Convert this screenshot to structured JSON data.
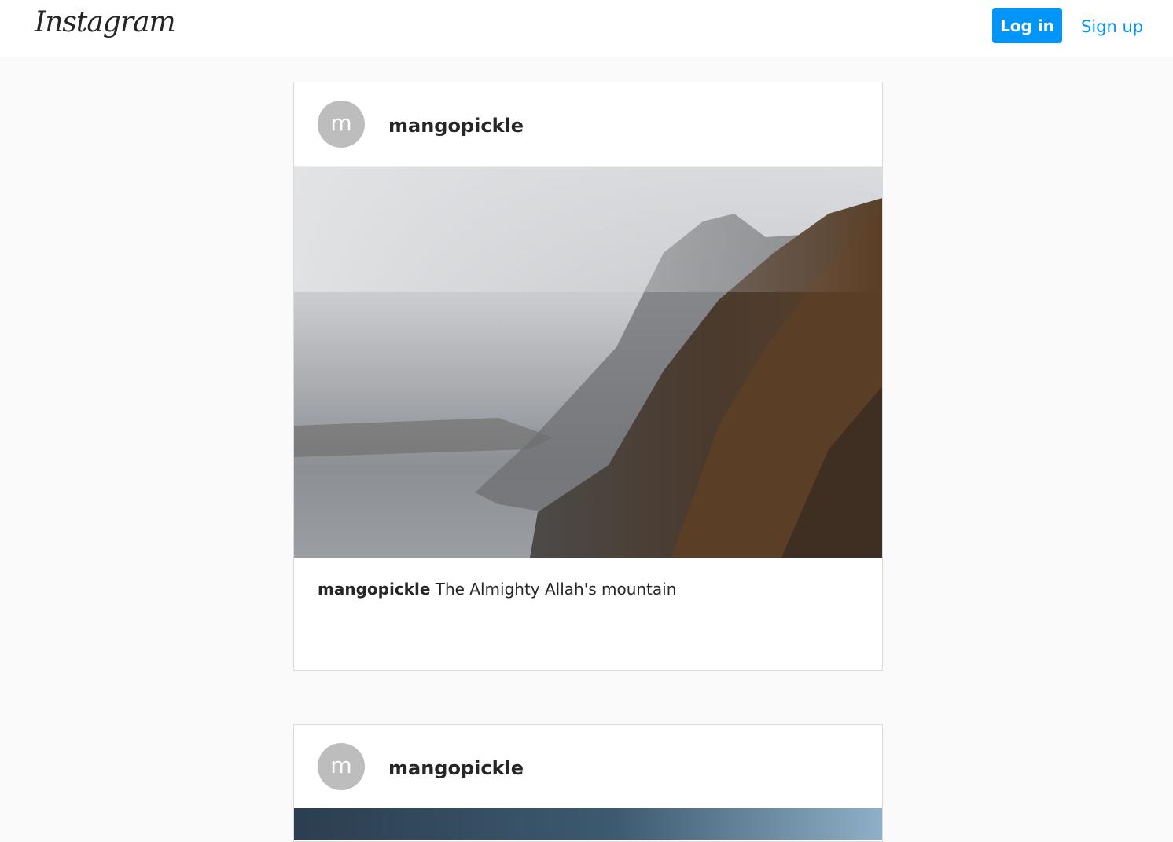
{
  "header": {
    "logo": "Instagram",
    "login_label": "Log in",
    "signup_label": "Sign up"
  },
  "posts": [
    {
      "avatar_letter": "m",
      "username": "mangopickle",
      "caption_user": "mangopickle",
      "caption_text": "The Almighty Allah's mountain"
    },
    {
      "avatar_letter": "m",
      "username": "mangopickle"
    }
  ],
  "colors": {
    "accent": "#0095f6",
    "avatar_bg": "#bdbdbd",
    "page_bg": "#fafafa",
    "border": "#dbdbdb"
  }
}
